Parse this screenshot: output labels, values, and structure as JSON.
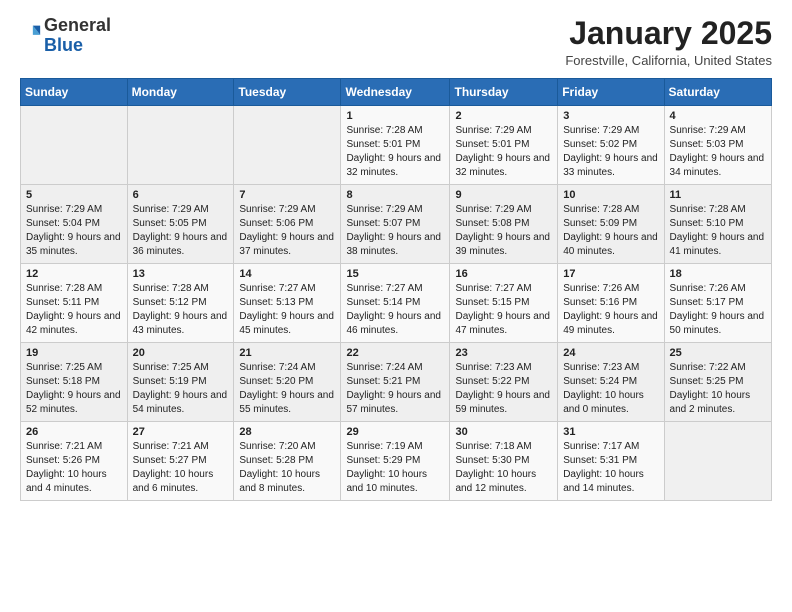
{
  "header": {
    "logo_general": "General",
    "logo_blue": "Blue",
    "title": "January 2025",
    "subtitle": "Forestville, California, United States"
  },
  "calendar": {
    "days_of_week": [
      "Sunday",
      "Monday",
      "Tuesday",
      "Wednesday",
      "Thursday",
      "Friday",
      "Saturday"
    ],
    "weeks": [
      [
        {
          "day": "",
          "info": ""
        },
        {
          "day": "",
          "info": ""
        },
        {
          "day": "",
          "info": ""
        },
        {
          "day": "1",
          "info": "Sunrise: 7:28 AM\nSunset: 5:01 PM\nDaylight: 9 hours and 32 minutes."
        },
        {
          "day": "2",
          "info": "Sunrise: 7:29 AM\nSunset: 5:01 PM\nDaylight: 9 hours and 32 minutes."
        },
        {
          "day": "3",
          "info": "Sunrise: 7:29 AM\nSunset: 5:02 PM\nDaylight: 9 hours and 33 minutes."
        },
        {
          "day": "4",
          "info": "Sunrise: 7:29 AM\nSunset: 5:03 PM\nDaylight: 9 hours and 34 minutes."
        }
      ],
      [
        {
          "day": "5",
          "info": "Sunrise: 7:29 AM\nSunset: 5:04 PM\nDaylight: 9 hours and 35 minutes."
        },
        {
          "day": "6",
          "info": "Sunrise: 7:29 AM\nSunset: 5:05 PM\nDaylight: 9 hours and 36 minutes."
        },
        {
          "day": "7",
          "info": "Sunrise: 7:29 AM\nSunset: 5:06 PM\nDaylight: 9 hours and 37 minutes."
        },
        {
          "day": "8",
          "info": "Sunrise: 7:29 AM\nSunset: 5:07 PM\nDaylight: 9 hours and 38 minutes."
        },
        {
          "day": "9",
          "info": "Sunrise: 7:29 AM\nSunset: 5:08 PM\nDaylight: 9 hours and 39 minutes."
        },
        {
          "day": "10",
          "info": "Sunrise: 7:28 AM\nSunset: 5:09 PM\nDaylight: 9 hours and 40 minutes."
        },
        {
          "day": "11",
          "info": "Sunrise: 7:28 AM\nSunset: 5:10 PM\nDaylight: 9 hours and 41 minutes."
        }
      ],
      [
        {
          "day": "12",
          "info": "Sunrise: 7:28 AM\nSunset: 5:11 PM\nDaylight: 9 hours and 42 minutes."
        },
        {
          "day": "13",
          "info": "Sunrise: 7:28 AM\nSunset: 5:12 PM\nDaylight: 9 hours and 43 minutes."
        },
        {
          "day": "14",
          "info": "Sunrise: 7:27 AM\nSunset: 5:13 PM\nDaylight: 9 hours and 45 minutes."
        },
        {
          "day": "15",
          "info": "Sunrise: 7:27 AM\nSunset: 5:14 PM\nDaylight: 9 hours and 46 minutes."
        },
        {
          "day": "16",
          "info": "Sunrise: 7:27 AM\nSunset: 5:15 PM\nDaylight: 9 hours and 47 minutes."
        },
        {
          "day": "17",
          "info": "Sunrise: 7:26 AM\nSunset: 5:16 PM\nDaylight: 9 hours and 49 minutes."
        },
        {
          "day": "18",
          "info": "Sunrise: 7:26 AM\nSunset: 5:17 PM\nDaylight: 9 hours and 50 minutes."
        }
      ],
      [
        {
          "day": "19",
          "info": "Sunrise: 7:25 AM\nSunset: 5:18 PM\nDaylight: 9 hours and 52 minutes."
        },
        {
          "day": "20",
          "info": "Sunrise: 7:25 AM\nSunset: 5:19 PM\nDaylight: 9 hours and 54 minutes."
        },
        {
          "day": "21",
          "info": "Sunrise: 7:24 AM\nSunset: 5:20 PM\nDaylight: 9 hours and 55 minutes."
        },
        {
          "day": "22",
          "info": "Sunrise: 7:24 AM\nSunset: 5:21 PM\nDaylight: 9 hours and 57 minutes."
        },
        {
          "day": "23",
          "info": "Sunrise: 7:23 AM\nSunset: 5:22 PM\nDaylight: 9 hours and 59 minutes."
        },
        {
          "day": "24",
          "info": "Sunrise: 7:23 AM\nSunset: 5:24 PM\nDaylight: 10 hours and 0 minutes."
        },
        {
          "day": "25",
          "info": "Sunrise: 7:22 AM\nSunset: 5:25 PM\nDaylight: 10 hours and 2 minutes."
        }
      ],
      [
        {
          "day": "26",
          "info": "Sunrise: 7:21 AM\nSunset: 5:26 PM\nDaylight: 10 hours and 4 minutes."
        },
        {
          "day": "27",
          "info": "Sunrise: 7:21 AM\nSunset: 5:27 PM\nDaylight: 10 hours and 6 minutes."
        },
        {
          "day": "28",
          "info": "Sunrise: 7:20 AM\nSunset: 5:28 PM\nDaylight: 10 hours and 8 minutes."
        },
        {
          "day": "29",
          "info": "Sunrise: 7:19 AM\nSunset: 5:29 PM\nDaylight: 10 hours and 10 minutes."
        },
        {
          "day": "30",
          "info": "Sunrise: 7:18 AM\nSunset: 5:30 PM\nDaylight: 10 hours and 12 minutes."
        },
        {
          "day": "31",
          "info": "Sunrise: 7:17 AM\nSunset: 5:31 PM\nDaylight: 10 hours and 14 minutes."
        },
        {
          "day": "",
          "info": ""
        }
      ]
    ]
  }
}
